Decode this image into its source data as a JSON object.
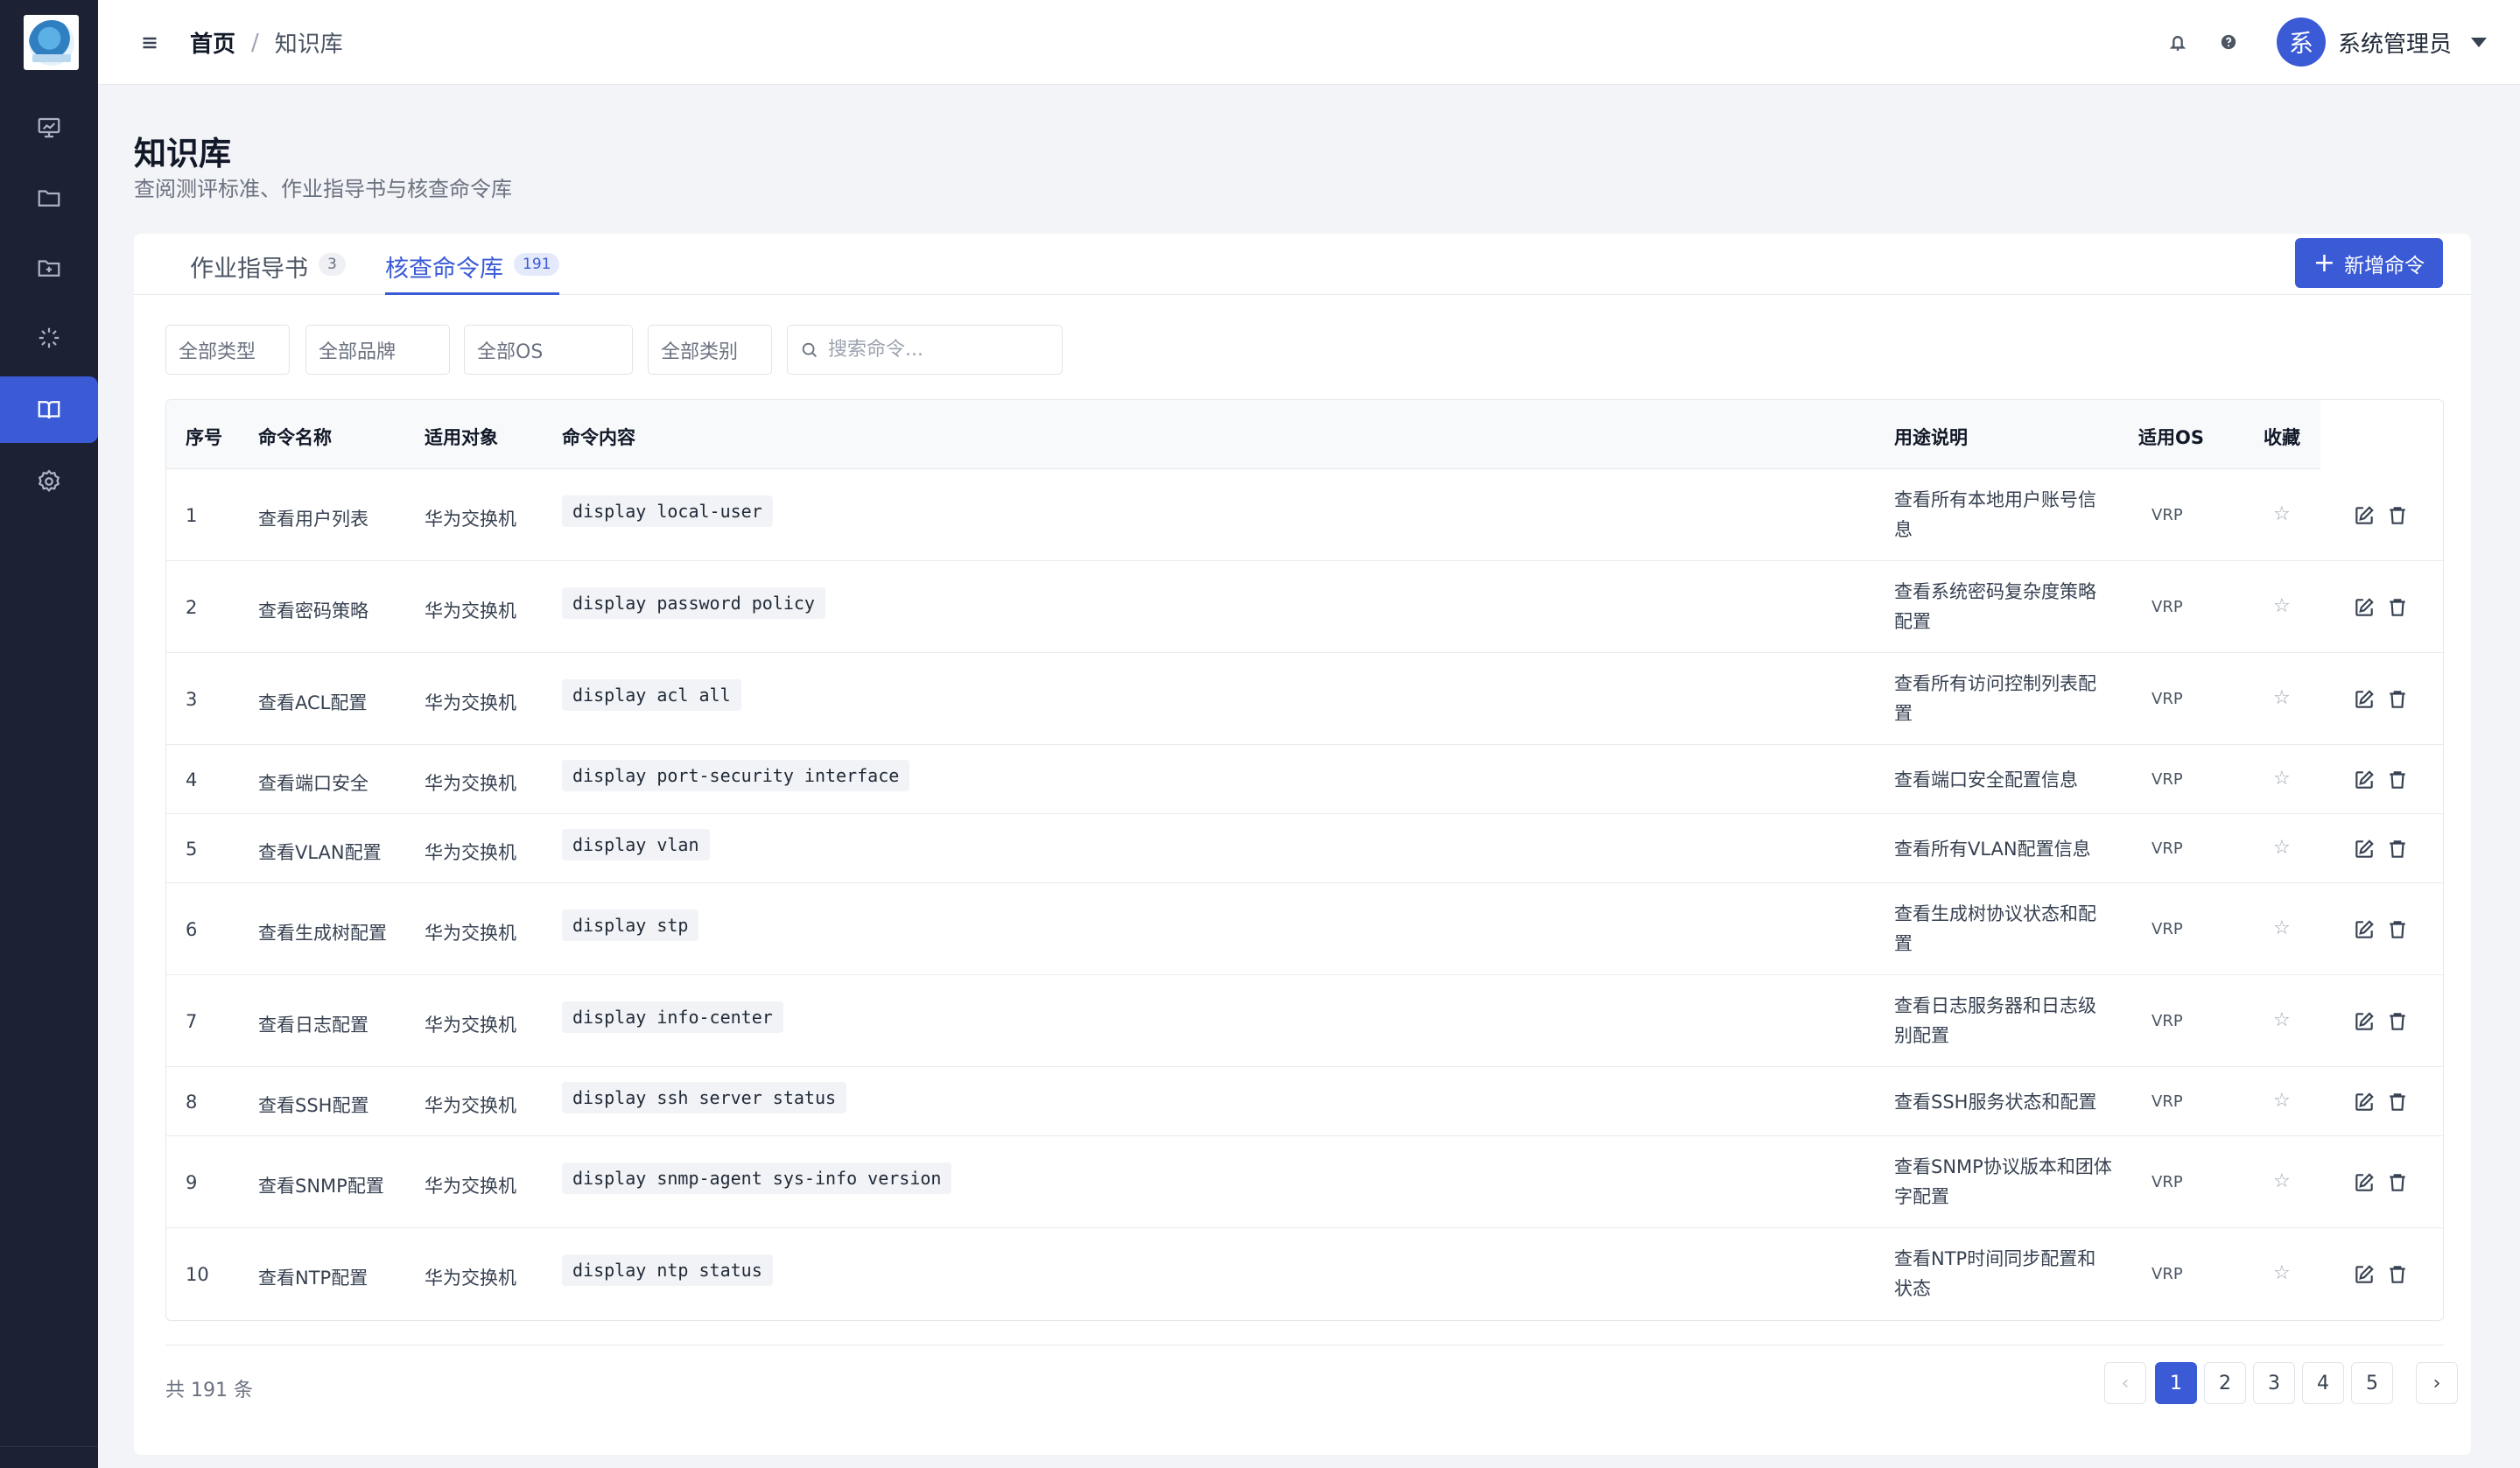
{
  "breadcrumb": {
    "home": "首页",
    "separator": "/",
    "current": "知识库"
  },
  "header": {
    "user_avatar": "系",
    "user_name": "系统管理员"
  },
  "page": {
    "title": "知识库",
    "subtitle": "查阅测评标准、作业指导书与核查命令库"
  },
  "tabs": [
    {
      "label": "作业指导书",
      "count": "3"
    },
    {
      "label": "核查命令库",
      "count": "191"
    }
  ],
  "add_button": {
    "label": "新增命令"
  },
  "filters": {
    "type": "全部类型",
    "brand": "全部品牌",
    "os": "全部OS",
    "category": "全部类别",
    "search_placeholder": "搜索命令..."
  },
  "table": {
    "headers": {
      "index": "序号",
      "name": "命令名称",
      "target": "适用对象",
      "content": "命令内容",
      "desc": "用途说明",
      "os": "适用OS",
      "fav": "收藏"
    },
    "rows": [
      {
        "index": "1",
        "name": "查看用户列表",
        "target": "华为交换机",
        "command": "display local-user",
        "desc": "查看所有本地用户账号信息",
        "os": "VRP",
        "fav": "☆"
      },
      {
        "index": "2",
        "name": "查看密码策略",
        "target": "华为交换机",
        "command": "display password policy",
        "desc": "查看系统密码复杂度策略配置",
        "os": "VRP",
        "fav": "☆"
      },
      {
        "index": "3",
        "name": "查看ACL配置",
        "target": "华为交换机",
        "command": "display acl all",
        "desc": "查看所有访问控制列表配置",
        "os": "VRP",
        "fav": "☆"
      },
      {
        "index": "4",
        "name": "查看端口安全",
        "target": "华为交换机",
        "command": "display port-security interface",
        "desc": "查看端口安全配置信息",
        "os": "VRP",
        "fav": "☆"
      },
      {
        "index": "5",
        "name": "查看VLAN配置",
        "target": "华为交换机",
        "command": "display vlan",
        "desc": "查看所有VLAN配置信息",
        "os": "VRP",
        "fav": "☆"
      },
      {
        "index": "6",
        "name": "查看生成树配置",
        "target": "华为交换机",
        "command": "display stp",
        "desc": "查看生成树协议状态和配置",
        "os": "VRP",
        "fav": "☆"
      },
      {
        "index": "7",
        "name": "查看日志配置",
        "target": "华为交换机",
        "command": "display info-center",
        "desc": "查看日志服务器和日志级别配置",
        "os": "VRP",
        "fav": "☆"
      },
      {
        "index": "8",
        "name": "查看SSH配置",
        "target": "华为交换机",
        "command": "display ssh server status",
        "desc": "查看SSH服务状态和配置",
        "os": "VRP",
        "fav": "☆"
      },
      {
        "index": "9",
        "name": "查看SNMP配置",
        "target": "华为交换机",
        "command": "display snmp-agent sys-info version",
        "desc": "查看SNMP协议版本和团体字配置",
        "os": "VRP",
        "fav": "☆"
      },
      {
        "index": "10",
        "name": "查看NTP配置",
        "target": "华为交换机",
        "command": "display ntp status",
        "desc": "查看NTP时间同步配置和状态",
        "os": "VRP",
        "fav": "☆"
      }
    ]
  },
  "pagination": {
    "total": "共 191 条",
    "pages": [
      "1",
      "2",
      "3",
      "4",
      "5"
    ],
    "current": "1",
    "prev": "‹",
    "next": "›"
  },
  "colors": {
    "accent": "#3b5bd6",
    "sidebar": "#1c2234"
  },
  "icons": {
    "nav": [
      "dashboard-icon",
      "folder-icon",
      "folder-plus-icon",
      "loader-icon",
      "book-open-icon",
      "settings-icon"
    ],
    "header": [
      "menu-icon",
      "bell-icon",
      "help-icon"
    ],
    "row_actions": [
      "edit-icon",
      "trash-icon"
    ]
  }
}
